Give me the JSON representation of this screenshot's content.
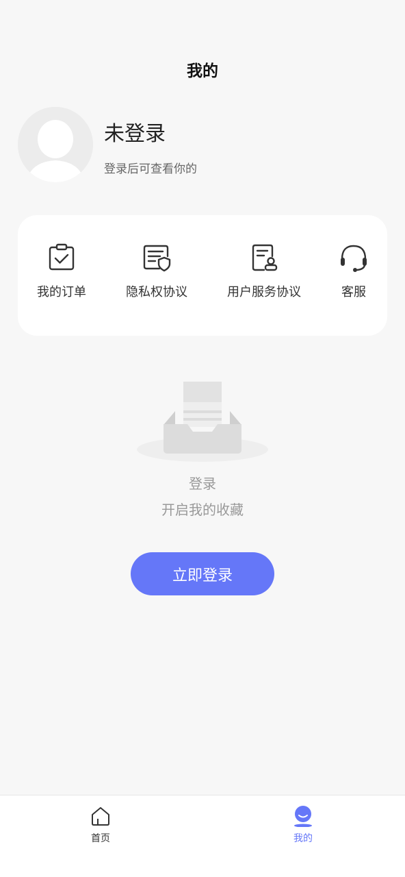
{
  "header": {
    "title": "我的"
  },
  "profile": {
    "status": "未登录",
    "hint": "登录后可查看你的"
  },
  "menu": {
    "items": [
      {
        "label": "我的订单",
        "icon": "order-check-icon"
      },
      {
        "label": "隐私权协议",
        "icon": "privacy-doc-icon"
      },
      {
        "label": "用户服务协议",
        "icon": "user-agreement-icon"
      },
      {
        "label": "客服",
        "icon": "headset-icon"
      }
    ]
  },
  "empty": {
    "title": "登录",
    "subtitle": "开启我的收藏",
    "icon": "empty-inbox-illustration"
  },
  "login_button": {
    "label": "立即登录"
  },
  "tabbar": {
    "items": [
      {
        "label": "首页",
        "icon": "home-icon",
        "active": false
      },
      {
        "label": "我的",
        "icon": "profile-icon",
        "active": true
      }
    ]
  },
  "colors": {
    "accent": "#6577f8",
    "background": "#f7f7f7",
    "tab_inactive": "#333333"
  }
}
